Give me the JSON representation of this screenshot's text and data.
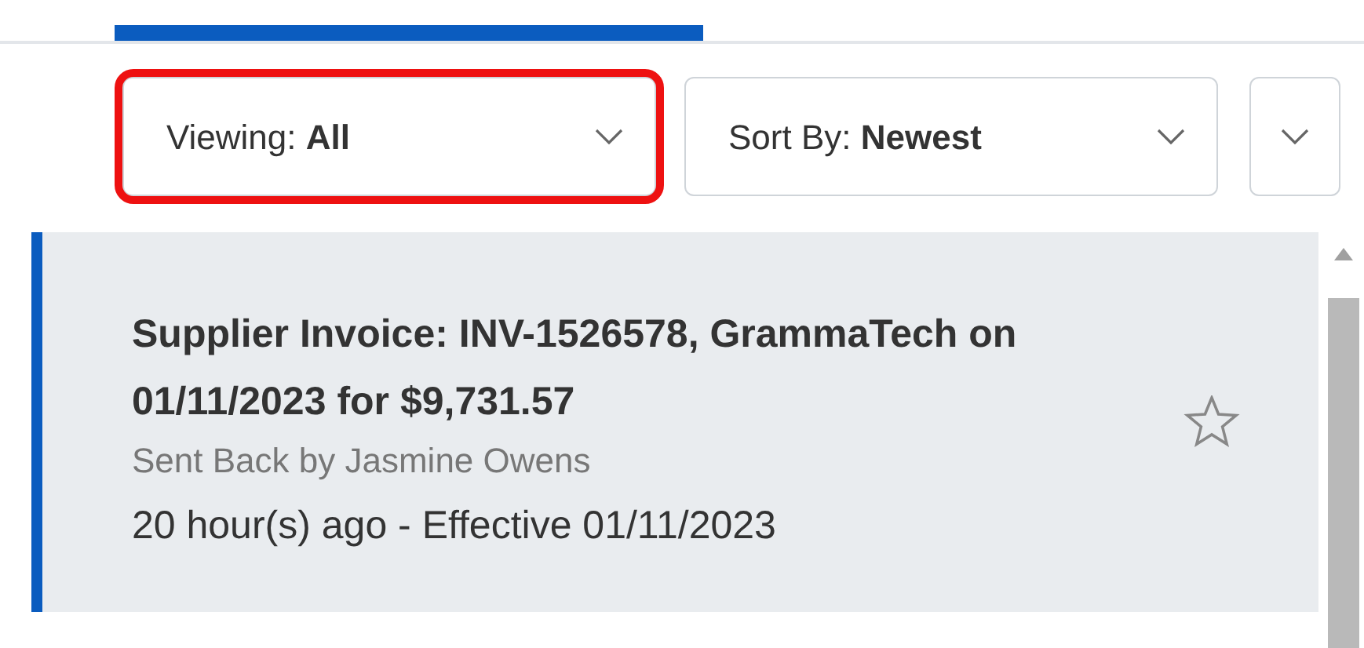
{
  "tab_bar": {
    "active_indicator": true
  },
  "filters": [
    {
      "label": "Viewing:",
      "value": "All",
      "highlighted": true
    },
    {
      "label": "Sort By:",
      "value": "Newest",
      "highlighted": false
    }
  ],
  "expand_button": {
    "kind": "chevron"
  },
  "items": [
    {
      "title": "Supplier Invoice: INV-1526578, GrammaTech on 01/11/2023 for $9,731.57",
      "subtitle": "Sent Back by Jasmine Owens",
      "meta": "20 hour(s) ago - Effective 01/11/2023",
      "starred": false,
      "selected": true
    }
  ]
}
